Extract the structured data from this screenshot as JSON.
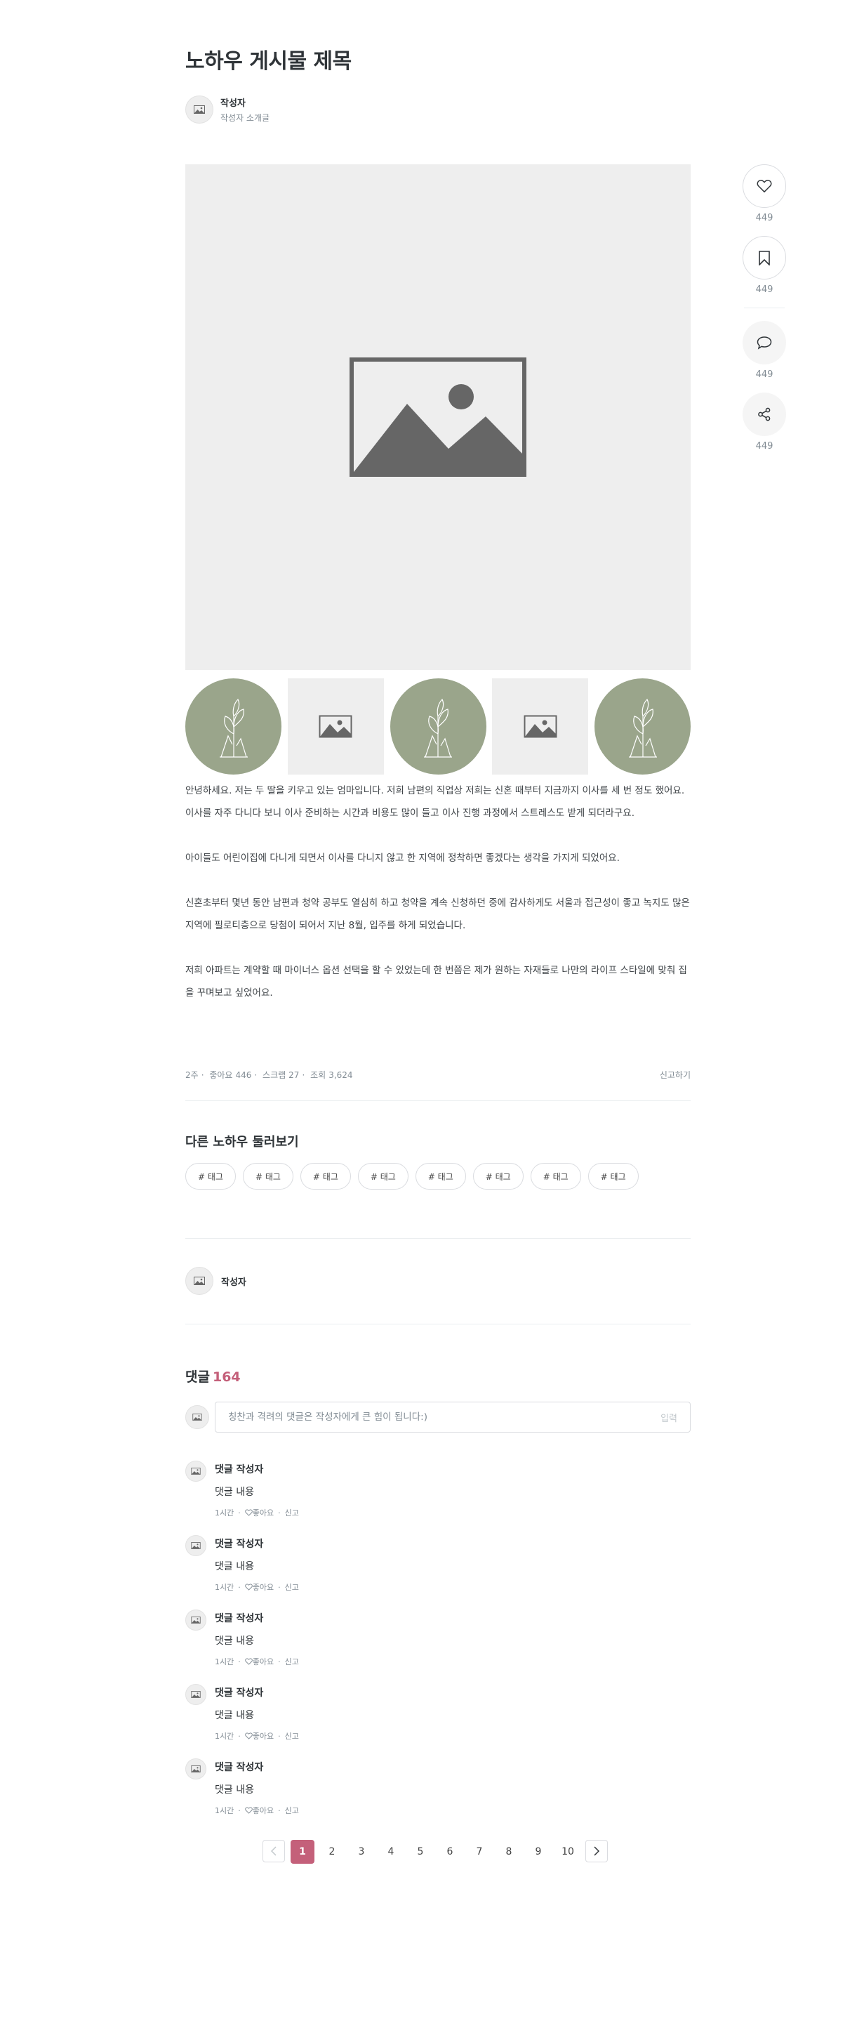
{
  "post": {
    "title": "노하우 게시물 제목",
    "author_name": "작성자",
    "author_bio": "작성자 소개글",
    "paragraphs": [
      "안녕하세요. 저는 두 딸을 키우고 있는 엄마입니다. 저희 남편의 직업상 저희는 신혼 때부터 지금까지 이사를 세 번 정도 했어요. 이사를 자주 다니다 보니 이사 준비하는 시간과 비용도 많이 들고 이사 진행 과정에서 스트레스도 받게 되더라구요.",
      "아이들도 어린이집에 다니게 되면서 이사를 다니지 않고 한 지역에 정착하면 좋겠다는 생각을 가지게 되었어요.",
      "신혼초부터 몇년 동안 남편과 청약 공부도 열심히 하고 청약을 계속 신청하던 중에 감사하게도 서울과 접근성이 좋고 녹지도 많은 지역에 필로티층으로 당첨이 되어서 지난 8월, 입주를 하게 되었습니다.",
      "저희 아파트는 계약할 때 마이너스 옵션 선택을 할 수 있었는데 한 번쯤은 제가 원하는 자재들로 나만의 라이프 스타일에 맞춰 집을 꾸며보고 싶었어요."
    ]
  },
  "meta": {
    "time": "2주",
    "likes_label": "좋아요",
    "likes": "446",
    "scraps_label": "스크랩",
    "scraps": "27",
    "views_label": "조회",
    "views": "3,624",
    "report_label": "신고하기"
  },
  "related": {
    "title": "다른 노하우 둘러보기",
    "tags": [
      "# 태그",
      "# 태그",
      "# 태그",
      "# 태그",
      "# 태그",
      "# 태그",
      "# 태그",
      "# 태그"
    ]
  },
  "author_section": {
    "name": "작성자"
  },
  "comments": {
    "title": "댓글",
    "count": "164",
    "input_placeholder": "칭찬과 격려의 댓글은 작성자에게 큰 힘이 됩니다:)",
    "submit_label": "입력",
    "items": [
      {
        "author": "댓글 작성자",
        "text": "댓글 내용",
        "time": "1시간",
        "like": "좋아요",
        "report": "신고"
      },
      {
        "author": "댓글 작성자",
        "text": "댓글 내용",
        "time": "1시간",
        "like": "좋아요",
        "report": "신고"
      },
      {
        "author": "댓글 작성자",
        "text": "댓글 내용",
        "time": "1시간",
        "like": "좋아요",
        "report": "신고"
      },
      {
        "author": "댓글 작성자",
        "text": "댓글 내용",
        "time": "1시간",
        "like": "좋아요",
        "report": "신고"
      },
      {
        "author": "댓글 작성자",
        "text": "댓글 내용",
        "time": "1시간",
        "like": "좋아요",
        "report": "신고"
      }
    ]
  },
  "pagination": {
    "current": "1",
    "pages": [
      "1",
      "2",
      "3",
      "4",
      "5",
      "6",
      "7",
      "8",
      "9",
      "10"
    ]
  },
  "side_actions": {
    "like_count": "449",
    "scrap_count": "449",
    "comment_count": "449",
    "share_count": "449"
  },
  "colors": {
    "accent": "#c4607a",
    "thumb_green": "#9aa58b",
    "placeholder_gray": "#eeeeee",
    "icon_gray": "#666666"
  },
  "icons": [
    "image-placeholder-icon",
    "plant-illustration",
    "heart-icon",
    "bookmark-icon",
    "comment-icon",
    "share-icon",
    "chevron-left-icon",
    "chevron-right-icon"
  ]
}
